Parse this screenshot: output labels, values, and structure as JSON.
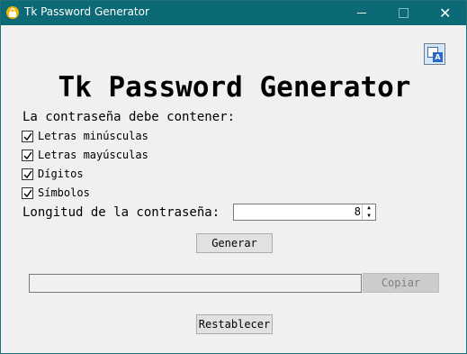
{
  "window": {
    "title": "Tk Password Generator",
    "minimize_glyph": "—",
    "close_glyph": "✕"
  },
  "main": {
    "heading": "Tk Password Generator",
    "requirements_label": "La contraseña debe contener:",
    "options": [
      {
        "label": "Letras minúsculas",
        "checked": true
      },
      {
        "label": "Letras mayúsculas",
        "checked": true
      },
      {
        "label": "Dígitos",
        "checked": true
      },
      {
        "label": "Símbolos",
        "checked": true
      }
    ],
    "length_label": "Longitud de la contraseña:",
    "length_value": "8",
    "generate_label": "Generar",
    "output_value": "",
    "copy_label": "Copiar",
    "reset_label": "Restablecer"
  },
  "icons": {
    "app": "lock-icon",
    "translate": "translate-icon",
    "translate_letter": "A"
  },
  "colors": {
    "titlebar": "#0b6a75",
    "app_icon": "#f5b400",
    "background": "#f0f0f0"
  }
}
